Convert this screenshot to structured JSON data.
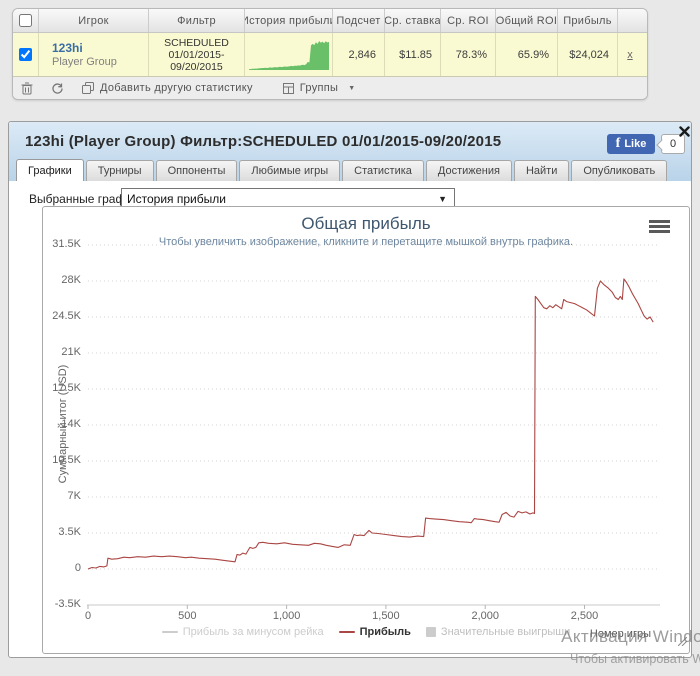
{
  "stats_table": {
    "headers": [
      "Игрок",
      "Фильтр",
      "История прибыли",
      "Подсчет",
      "Ср. ставка",
      "Ср. ROI",
      "Общий ROI",
      "Прибыль"
    ],
    "row": {
      "player": "123hi",
      "player_type": "Player Group",
      "filter": "SCHEDULED 01/01/2015- 09/20/2015",
      "count": "2,846",
      "avg_stake": "$11.85",
      "avg_roi": "78.3%",
      "total_roi": "65.9%",
      "profit": "$24,024",
      "remove_label": "x",
      "checked": true
    },
    "toolbar": {
      "add_stat_label": "Добавить другую статистику",
      "groups_label": "Группы",
      "groups_arrow": "▼"
    },
    "sparkline": {
      "color": "#6abf69",
      "values": [
        0.03,
        0.03,
        0.04,
        0.04,
        0.05,
        0.05,
        0.06,
        0.06,
        0.07,
        0.07,
        0.08,
        0.07,
        0.08,
        0.09,
        0.08,
        0.09,
        0.1,
        0.09,
        0.1,
        0.11,
        0.1,
        0.11,
        0.12,
        0.11,
        0.12,
        0.13,
        0.14,
        0.13,
        0.15,
        0.14,
        0.16,
        0.15,
        0.17,
        0.18,
        0.17,
        0.2,
        0.28,
        0.26,
        0.85,
        0.9,
        0.86,
        0.96,
        0.9,
        1.0,
        0.94,
        0.98,
        0.92,
        0.99,
        0.95,
        0.97
      ]
    }
  },
  "window": {
    "title": "123hi (Player Group) Фильтр:SCHEDULED 01/01/2015-09/20/2015",
    "like": {
      "label": "Like",
      "count": "0",
      "f_glyph": "f"
    },
    "tabs": [
      {
        "label": "Графики",
        "active": true
      },
      {
        "label": "Турниры",
        "active": false
      },
      {
        "label": "Оппоненты",
        "active": false
      },
      {
        "label": "Любимые игры",
        "active": false
      },
      {
        "label": "Статистика",
        "active": false
      },
      {
        "label": "Достижения",
        "active": false
      },
      {
        "label": "Найти",
        "active": false
      },
      {
        "label": "Опубликовать",
        "active": false
      }
    ],
    "chart_picker": {
      "label": "Выбранные графики:",
      "value": "История прибыли",
      "arrow": "▼"
    }
  },
  "chart_data": {
    "type": "line",
    "title": "Общая прибыль",
    "subtitle": "Чтобы увеличить изображение, кликните и перетащите мышкой внутрь графика.",
    "xlabel": "Номер игры",
    "ylabel": "Суммарный итог (USD)",
    "xlim": [
      0,
      2880
    ],
    "ylim": [
      -3500,
      31500
    ],
    "x_ticks": {
      "values": [
        0,
        500,
        1000,
        1500,
        2000,
        2500
      ],
      "labels": [
        "0",
        "500",
        "1,000",
        "1,500",
        "2,000",
        "2,500"
      ]
    },
    "y_ticks": {
      "values": [
        -3500,
        0,
        3500,
        7000,
        10500,
        14000,
        17500,
        21000,
        24500,
        28000,
        31500
      ],
      "labels": [
        "-3.5K",
        "0",
        "3.5K",
        "7K",
        "10.5K",
        "14K",
        "17.5K",
        "21K",
        "24.5K",
        "28K",
        "31.5K"
      ]
    },
    "grid": "dotted",
    "legend_position": "bottom",
    "legend": [
      {
        "label": "Прибыль за минусом рейка",
        "swatch": "line",
        "color": "#cccccc",
        "text_color": "#cccccc",
        "bold": false
      },
      {
        "label": "Прибыль",
        "swatch": "line",
        "color": "#AA4643",
        "text_color": "#333333",
        "bold": true
      },
      {
        "label": "Значительные выигрыши",
        "swatch": "box",
        "color": "#cccccc",
        "text_color": "#bfbfbf",
        "bold": false
      }
    ],
    "series": [
      {
        "name": "Прибыль",
        "color": "#AA4643",
        "points": [
          [
            0,
            0
          ],
          [
            20,
            150
          ],
          [
            40,
            100
          ],
          [
            60,
            250
          ],
          [
            80,
            200
          ],
          [
            95,
            300
          ],
          [
            100,
            1050
          ],
          [
            120,
            950
          ],
          [
            150,
            1000
          ],
          [
            180,
            1150
          ],
          [
            210,
            1100
          ],
          [
            250,
            1200
          ],
          [
            290,
            1150
          ],
          [
            330,
            1250
          ],
          [
            370,
            1200
          ],
          [
            410,
            1250
          ],
          [
            450,
            1200
          ],
          [
            490,
            1100
          ],
          [
            520,
            1150
          ],
          [
            560,
            1050
          ],
          [
            600,
            1000
          ],
          [
            640,
            950
          ],
          [
            680,
            850
          ],
          [
            720,
            750
          ],
          [
            740,
            700
          ],
          [
            750,
            1400
          ],
          [
            765,
            1350
          ],
          [
            780,
            1550
          ],
          [
            795,
            1450
          ],
          [
            815,
            2100
          ],
          [
            830,
            2000
          ],
          [
            845,
            2100
          ],
          [
            860,
            2550
          ],
          [
            880,
            2600
          ],
          [
            910,
            2500
          ],
          [
            950,
            2450
          ],
          [
            990,
            2550
          ],
          [
            1030,
            2400
          ],
          [
            1070,
            2350
          ],
          [
            1110,
            2300
          ],
          [
            1140,
            2500
          ],
          [
            1170,
            2450
          ],
          [
            1200,
            2300
          ],
          [
            1230,
            2200
          ],
          [
            1260,
            2100
          ],
          [
            1290,
            2350
          ],
          [
            1320,
            2300
          ],
          [
            1340,
            3350
          ],
          [
            1355,
            3250
          ],
          [
            1370,
            3300
          ],
          [
            1390,
            3250
          ],
          [
            1405,
            3550
          ],
          [
            1415,
            3750
          ],
          [
            1430,
            3500
          ],
          [
            1460,
            3450
          ],
          [
            1500,
            3350
          ],
          [
            1540,
            3250
          ],
          [
            1580,
            3150
          ],
          [
            1620,
            3100
          ],
          [
            1660,
            3200
          ],
          [
            1690,
            3150
          ],
          [
            1700,
            4950
          ],
          [
            1720,
            4900
          ],
          [
            1750,
            4850
          ],
          [
            1790,
            4800
          ],
          [
            1830,
            4700
          ],
          [
            1870,
            4600
          ],
          [
            1910,
            4550
          ],
          [
            1930,
            4500
          ],
          [
            1945,
            4900
          ],
          [
            1960,
            4850
          ],
          [
            1990,
            4800
          ],
          [
            2020,
            4700
          ],
          [
            2050,
            4600
          ],
          [
            2070,
            4550
          ],
          [
            2085,
            5300
          ],
          [
            2105,
            5500
          ],
          [
            2125,
            5150
          ],
          [
            2145,
            5050
          ],
          [
            2165,
            5600
          ],
          [
            2185,
            5450
          ],
          [
            2205,
            5550
          ],
          [
            2225,
            5350
          ],
          [
            2240,
            5450
          ],
          [
            2248,
            5400
          ],
          [
            2252,
            26500
          ],
          [
            2265,
            26200
          ],
          [
            2280,
            25800
          ],
          [
            2295,
            25400
          ],
          [
            2310,
            25300
          ],
          [
            2325,
            25600
          ],
          [
            2340,
            25400
          ],
          [
            2355,
            25700
          ],
          [
            2370,
            25500
          ],
          [
            2385,
            25300
          ],
          [
            2395,
            26200
          ],
          [
            2410,
            26000
          ],
          [
            2430,
            25900
          ],
          [
            2450,
            25800
          ],
          [
            2470,
            25600
          ],
          [
            2490,
            25400
          ],
          [
            2510,
            25200
          ],
          [
            2530,
            24900
          ],
          [
            2550,
            24600
          ],
          [
            2565,
            27300
          ],
          [
            2580,
            28000
          ],
          [
            2600,
            27600
          ],
          [
            2620,
            27300
          ],
          [
            2640,
            26900
          ],
          [
            2655,
            26400
          ],
          [
            2670,
            26200
          ],
          [
            2680,
            26500
          ],
          [
            2690,
            26200
          ],
          [
            2698,
            28200
          ],
          [
            2710,
            27900
          ],
          [
            2725,
            27400
          ],
          [
            2740,
            26800
          ],
          [
            2755,
            26300
          ],
          [
            2770,
            25800
          ],
          [
            2785,
            25200
          ],
          [
            2800,
            24600
          ],
          [
            2815,
            24300
          ],
          [
            2830,
            24500
          ],
          [
            2846,
            24000
          ]
        ]
      }
    ]
  },
  "watermark": {
    "line1": "Активация Windo",
    "line2": "Чтобы активировать W"
  }
}
